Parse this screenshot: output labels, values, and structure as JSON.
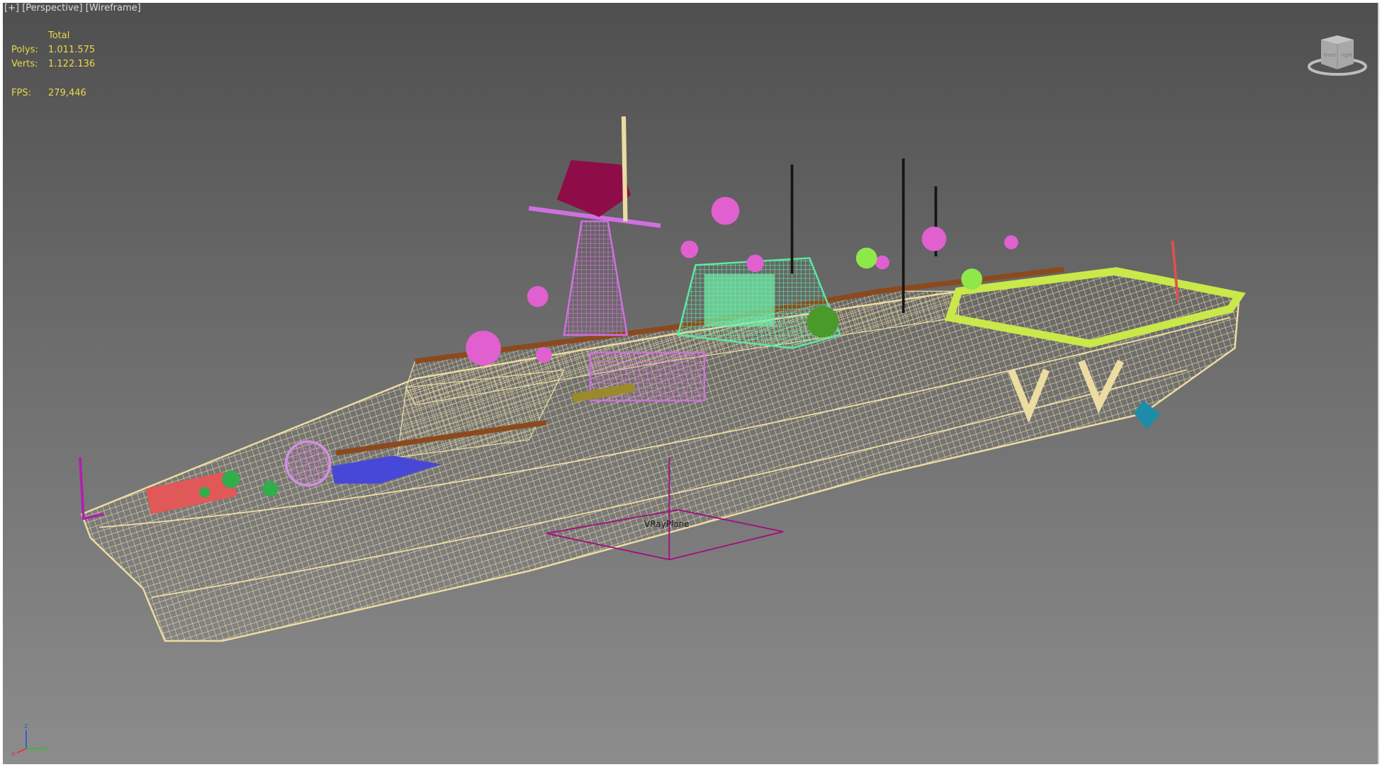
{
  "viewport": {
    "menu_plus": "[+]",
    "view_label": "[Perspective]",
    "shading_label": "[Wireframe]"
  },
  "stats": {
    "header": "Total",
    "polys_label": "Polys:",
    "polys_value": "1.011.575",
    "verts_label": "Verts:",
    "verts_value": "1.122.136",
    "fps_label": "FPS:",
    "fps_value": "279,446"
  },
  "scene": {
    "object_label": "VRayPlane",
    "wire_color": "#e9dba0",
    "bg_top": "#4f4f4f",
    "bg_bottom": "#8c8c8c"
  },
  "axes": {
    "x": "x",
    "y": "y",
    "z": "z"
  },
  "viewcube": {
    "left_face": "front",
    "right_face": "right"
  }
}
